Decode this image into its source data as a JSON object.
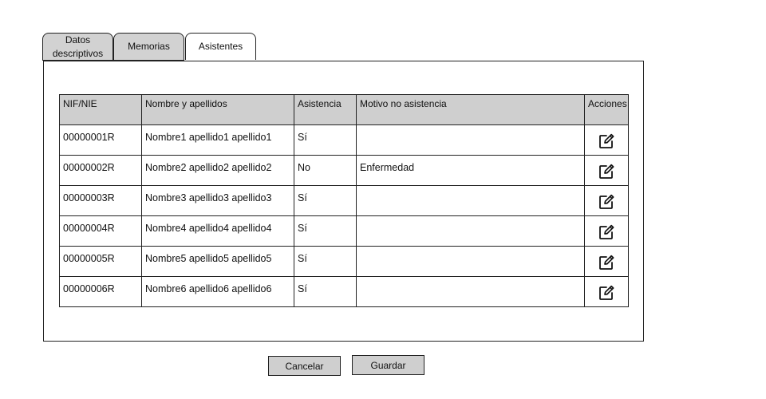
{
  "tabs": [
    {
      "label": "Datos descriptivos",
      "active": false
    },
    {
      "label": "Memorias",
      "active": false
    },
    {
      "label": "Asistentes",
      "active": true
    }
  ],
  "table": {
    "headers": [
      "NIF/NIE",
      "Nombre y apellidos",
      "Asistencia",
      "Motivo no asistencia",
      "Acciones"
    ],
    "rows": [
      {
        "nif": "00000001R",
        "nombre": "Nombre1 apellido1 apellido1",
        "asistencia": "Sí",
        "motivo": "",
        "action_icon": "edit-icon"
      },
      {
        "nif": "00000002R",
        "nombre": "Nombre2 apellido2 apellido2",
        "asistencia": "No",
        "motivo": "Enfermedad",
        "action_icon": "edit-icon"
      },
      {
        "nif": "00000003R",
        "nombre": "Nombre3 apellido3 apellido3",
        "asistencia": "Sí",
        "motivo": "",
        "action_icon": "edit-icon"
      },
      {
        "nif": "00000004R",
        "nombre": "Nombre4 apellido4 apellido4",
        "asistencia": "Sí",
        "motivo": "",
        "action_icon": "edit-icon"
      },
      {
        "nif": "00000005R",
        "nombre": "Nombre5 apellido5 apellido5",
        "asistencia": "Sí",
        "motivo": "",
        "action_icon": "edit-icon"
      },
      {
        "nif": "00000006R",
        "nombre": "Nombre6 apellido6 apellido6",
        "asistencia": "Sí",
        "motivo": "",
        "action_icon": "edit-icon"
      }
    ]
  },
  "buttons": {
    "cancel_label": "Cancelar",
    "save_label": "Guardar"
  },
  "colors": {
    "header_bg": "#cfcfcf",
    "border": "#222222",
    "tab_inactive_bg": "#d2d2d2"
  }
}
